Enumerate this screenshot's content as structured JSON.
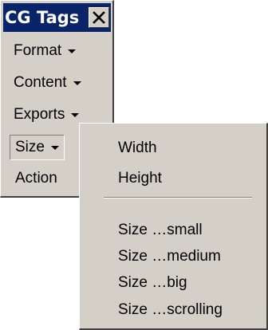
{
  "toolbar": {
    "title": "CG Tags",
    "close_icon": "close-x-icon",
    "items": [
      {
        "label": "Format",
        "has_dropdown": true
      },
      {
        "label": "Content",
        "has_dropdown": true
      },
      {
        "label": "Exports",
        "has_dropdown": true
      },
      {
        "label": "Size",
        "has_dropdown": true,
        "active": true
      },
      {
        "label": "Action",
        "has_dropdown": false
      }
    ]
  },
  "size_menu": {
    "items": [
      {
        "label": "Width"
      },
      {
        "label": "Height"
      },
      {
        "separator": true
      },
      {
        "label": "Size …small"
      },
      {
        "label": "Size …medium"
      },
      {
        "label": "Size …big"
      },
      {
        "label": "Size …scrolling"
      }
    ]
  },
  "colors": {
    "title_bar": "#0a246a",
    "face": "#d4d0c8",
    "title_text": "#ffffff"
  }
}
